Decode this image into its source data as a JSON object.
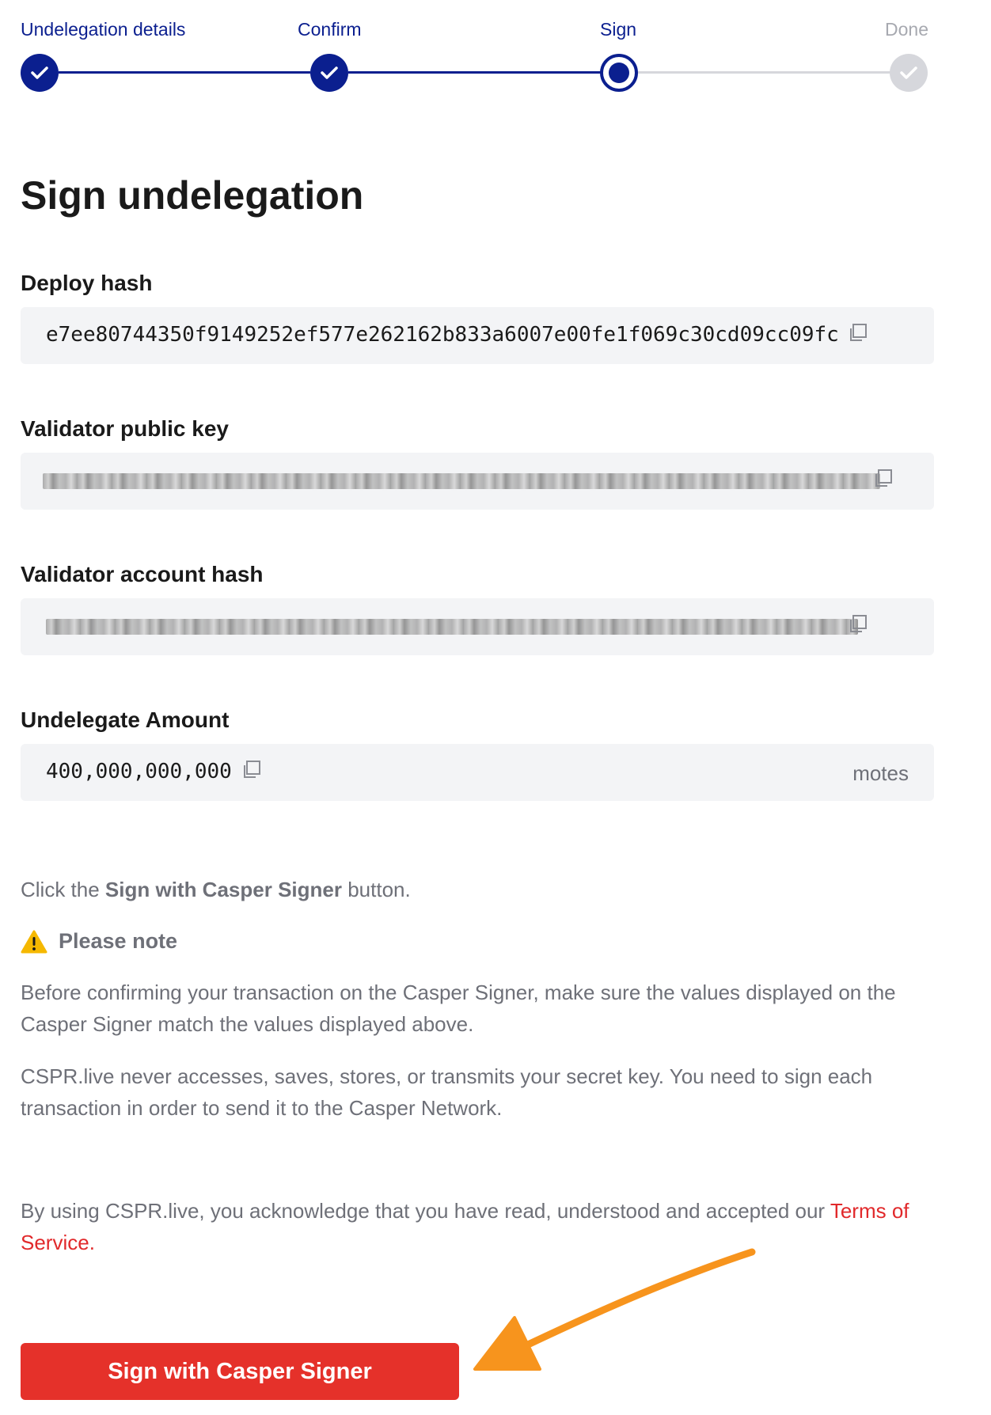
{
  "stepper": {
    "steps": [
      {
        "label": "Undelegation details",
        "state": "done"
      },
      {
        "label": "Confirm",
        "state": "done"
      },
      {
        "label": "Sign",
        "state": "current"
      },
      {
        "label": "Done",
        "state": "pending"
      }
    ]
  },
  "title": "Sign undelegation",
  "fields": {
    "deploy_hash": {
      "label": "Deploy hash",
      "value": "e7ee80744350f9149252ef577e262162b833a6007e00fe1f069c30cd09cc09fc",
      "icon": "copy-icon"
    },
    "validator_public_key": {
      "label": "Validator public key",
      "icon": "copy-icon"
    },
    "validator_account_hash": {
      "label": "Validator account hash",
      "icon": "copy-icon"
    },
    "undelegate_amount": {
      "label": "Undelegate Amount",
      "value": "400,000,000,000",
      "unit": "motes",
      "icon": "copy-icon"
    }
  },
  "instructions": {
    "click_prefix": "Click the ",
    "click_bold": "Sign with Casper Signer",
    "click_suffix": " button.",
    "note_icon": "warning-icon",
    "note_title": "Please note",
    "note_para_1": "Before confirming your transaction on the Casper Signer, make sure the values displayed on the Casper Signer match the values displayed above.",
    "note_para_2": "CSPR.live never accesses, saves, stores, or transmits your secret key. You need to sign each transaction in order to send it to the Casper Network.",
    "terms_prefix": "By using CSPR.live, you acknowledge that you have read, understood and accepted our ",
    "terms_link": "Terms of Service."
  },
  "sign_button": {
    "label": "Sign with Casper Signer"
  },
  "colors": {
    "primary": "#0b1f8f",
    "accent": "#e5312a",
    "arrow": "#f7941d",
    "field_bg": "#f3f4f6"
  }
}
